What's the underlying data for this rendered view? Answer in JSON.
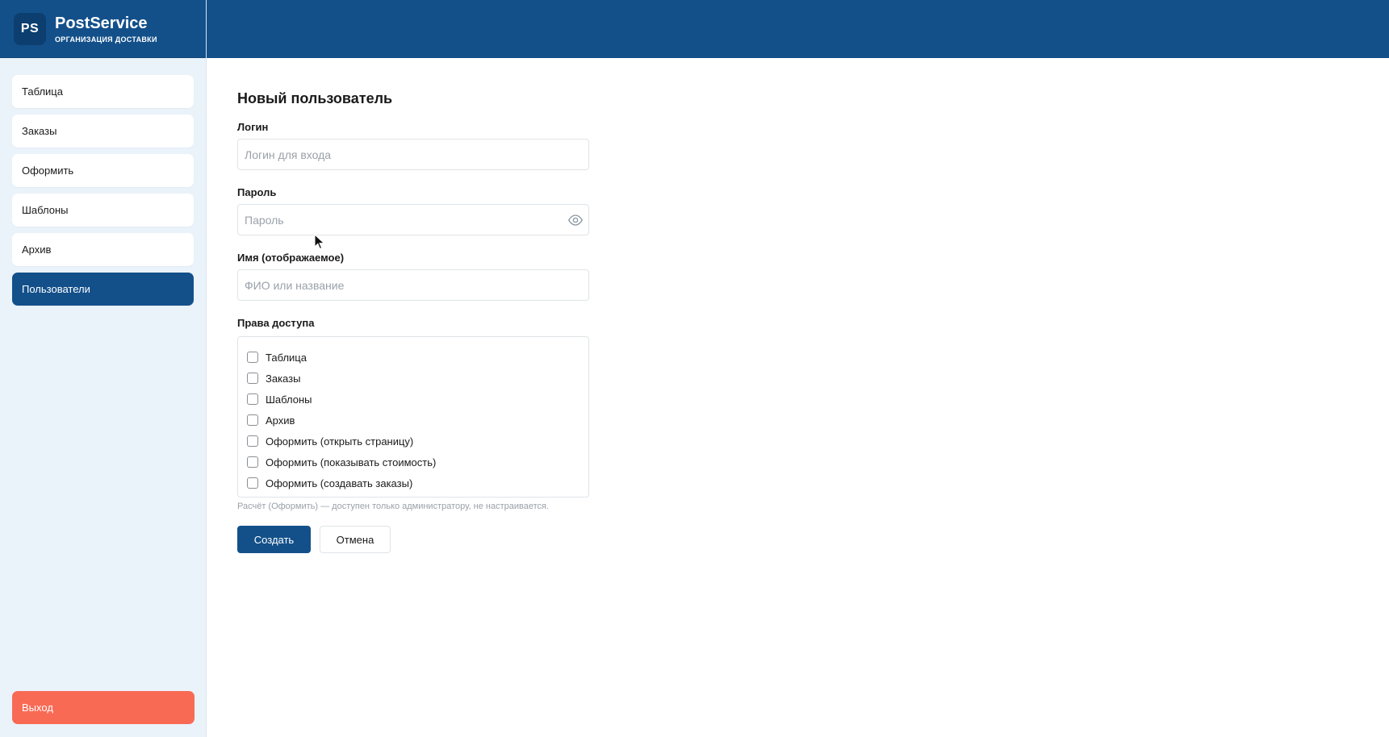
{
  "brand": {
    "logo_text": "PS",
    "name": "PostService",
    "subtitle": "ОРГАНИЗАЦИЯ ДОСТАВКИ"
  },
  "sidebar": {
    "items": [
      {
        "label": "Таблица"
      },
      {
        "label": "Заказы"
      },
      {
        "label": "Оформить"
      },
      {
        "label": "Шаблоны"
      },
      {
        "label": "Архив"
      },
      {
        "label": "Пользователи",
        "active": true
      }
    ],
    "logout_label": "Выход"
  },
  "form": {
    "title": "Новый пользователь",
    "login": {
      "label": "Логин",
      "value": "",
      "placeholder": "Логин для входа"
    },
    "password": {
      "label": "Пароль",
      "value": "",
      "placeholder": "Пароль",
      "icon": "eye-icon"
    },
    "display_name": {
      "label": "Имя (отображаемое)",
      "value": "",
      "placeholder": "ФИО или название"
    },
    "permissions": {
      "label": "Права доступа",
      "items": [
        {
          "label": "Таблица",
          "checked": false
        },
        {
          "label": "Заказы",
          "checked": false
        },
        {
          "label": "Шаблоны",
          "checked": false
        },
        {
          "label": "Архив",
          "checked": false
        },
        {
          "label": "Оформить (открыть страницу)",
          "checked": false
        },
        {
          "label": "Оформить (показывать стоимость)",
          "checked": false
        },
        {
          "label": "Оформить (создавать заказы)",
          "checked": false
        }
      ],
      "hint": "Расчёт (Оформить) — доступен только администратору, не настраивается."
    },
    "create_label": "Создать",
    "cancel_label": "Отмена"
  },
  "colors": {
    "primary": "#13508a",
    "sidebar_bg": "#eaf2fa",
    "logout": "#f96a55"
  }
}
